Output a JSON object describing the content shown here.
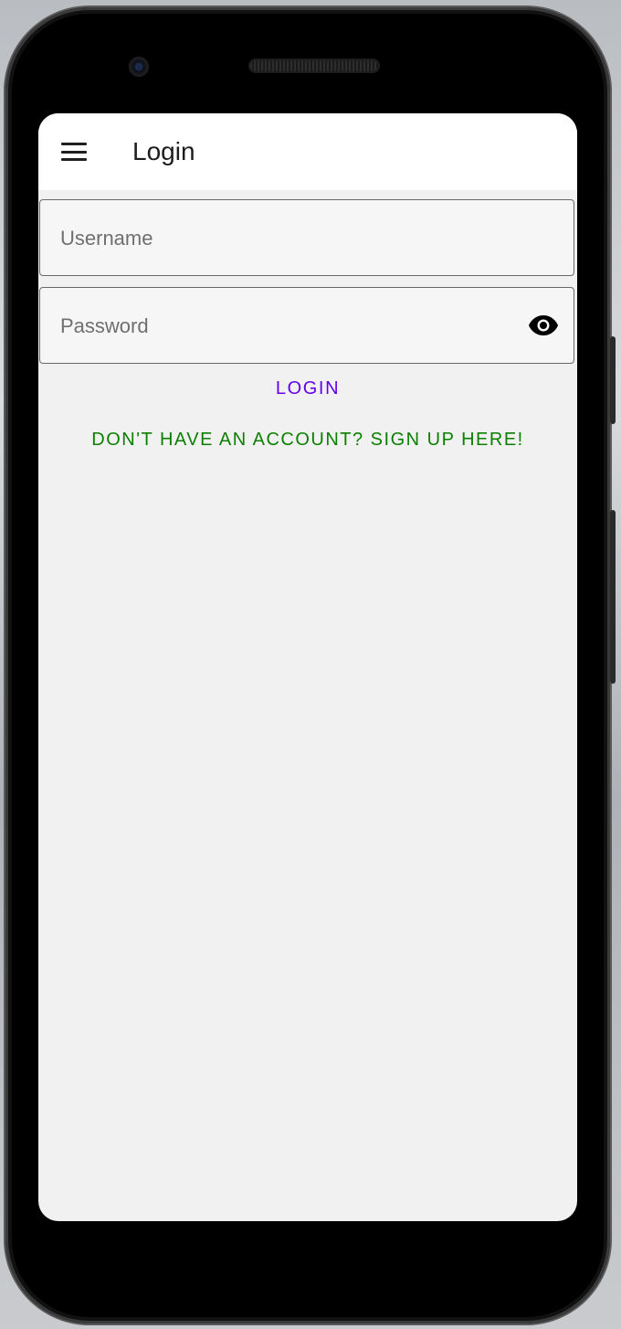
{
  "app_bar": {
    "title": "Login",
    "menu_icon": "hamburger-menu-icon"
  },
  "form": {
    "username": {
      "placeholder": "Username",
      "value": ""
    },
    "password": {
      "placeholder": "Password",
      "value": "",
      "toggle_icon": "eye-icon"
    }
  },
  "actions": {
    "login_label": "LOGIN",
    "signup_label": "DON'T HAVE AN ACCOUNT? SIGN UP HERE!"
  },
  "colors": {
    "primary": "#6200ee",
    "signup": "#0b8000",
    "background": "#f1f1f1",
    "app_bar": "#ffffff"
  }
}
